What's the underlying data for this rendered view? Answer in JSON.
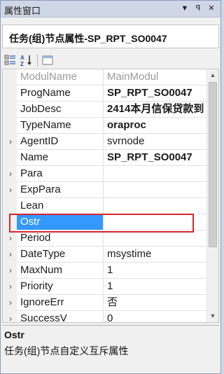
{
  "window": {
    "title": "属性窗口",
    "buttons": {
      "dropdown": "▼",
      "pin": "ꟼ",
      "close": "✕"
    }
  },
  "object_selector": {
    "value": "任务(组)节点属性-SP_RPT_SO0047"
  },
  "toolbar": {
    "buttons": [
      {
        "icon": "categorized-icon"
      },
      {
        "icon": "alphabetical-sort-icon"
      },
      {
        "icon": "property-pages-icon"
      }
    ]
  },
  "grid": {
    "rows": [
      {
        "name": "ModulName",
        "value": "MainModul",
        "expandable": false,
        "bold": false,
        "disabled": true,
        "selected": false
      },
      {
        "name": "ProgName",
        "value": "SP_RPT_SO0047",
        "expandable": false,
        "bold": true,
        "disabled": false,
        "selected": false
      },
      {
        "name": "JobDesc",
        "value": "2414本月信保贷款到",
        "expandable": false,
        "bold": true,
        "disabled": false,
        "selected": false
      },
      {
        "name": "TypeName",
        "value": "oraproc",
        "expandable": false,
        "bold": true,
        "disabled": false,
        "selected": false
      },
      {
        "name": "AgentID",
        "value": "svrnode",
        "expandable": true,
        "bold": false,
        "disabled": false,
        "selected": false
      },
      {
        "name": "Name",
        "value": "SP_RPT_SO0047",
        "expandable": false,
        "bold": true,
        "disabled": false,
        "selected": false
      },
      {
        "name": "Para",
        "value": "",
        "expandable": true,
        "bold": false,
        "disabled": false,
        "selected": false
      },
      {
        "name": "ExpPara",
        "value": "",
        "expandable": true,
        "bold": false,
        "disabled": false,
        "selected": false
      },
      {
        "name": "Lean",
        "value": "",
        "expandable": false,
        "bold": false,
        "disabled": false,
        "selected": false
      },
      {
        "name": "Ostr",
        "value": "",
        "expandable": false,
        "bold": false,
        "disabled": false,
        "selected": true
      },
      {
        "name": "Period",
        "value": "",
        "expandable": true,
        "bold": false,
        "disabled": false,
        "selected": false
      },
      {
        "name": "DateType",
        "value": "msystime",
        "expandable": true,
        "bold": false,
        "disabled": false,
        "selected": false
      },
      {
        "name": "MaxNum",
        "value": "1",
        "expandable": true,
        "bold": false,
        "disabled": false,
        "selected": false
      },
      {
        "name": "Priority",
        "value": "1",
        "expandable": true,
        "bold": false,
        "disabled": false,
        "selected": false
      },
      {
        "name": "IgnoreErr",
        "value": "否",
        "expandable": true,
        "bold": false,
        "disabled": false,
        "selected": false
      },
      {
        "name": "SuccessV",
        "value": "0",
        "expandable": true,
        "bold": false,
        "disabled": false,
        "selected": false
      }
    ]
  },
  "description": {
    "title": "Ostr",
    "text": "任务(组)节点自定义互斥属性"
  },
  "colors": {
    "selection": "#3399ff",
    "highlight_box": "#d9262c",
    "titlebar": "#cfd6e5"
  }
}
